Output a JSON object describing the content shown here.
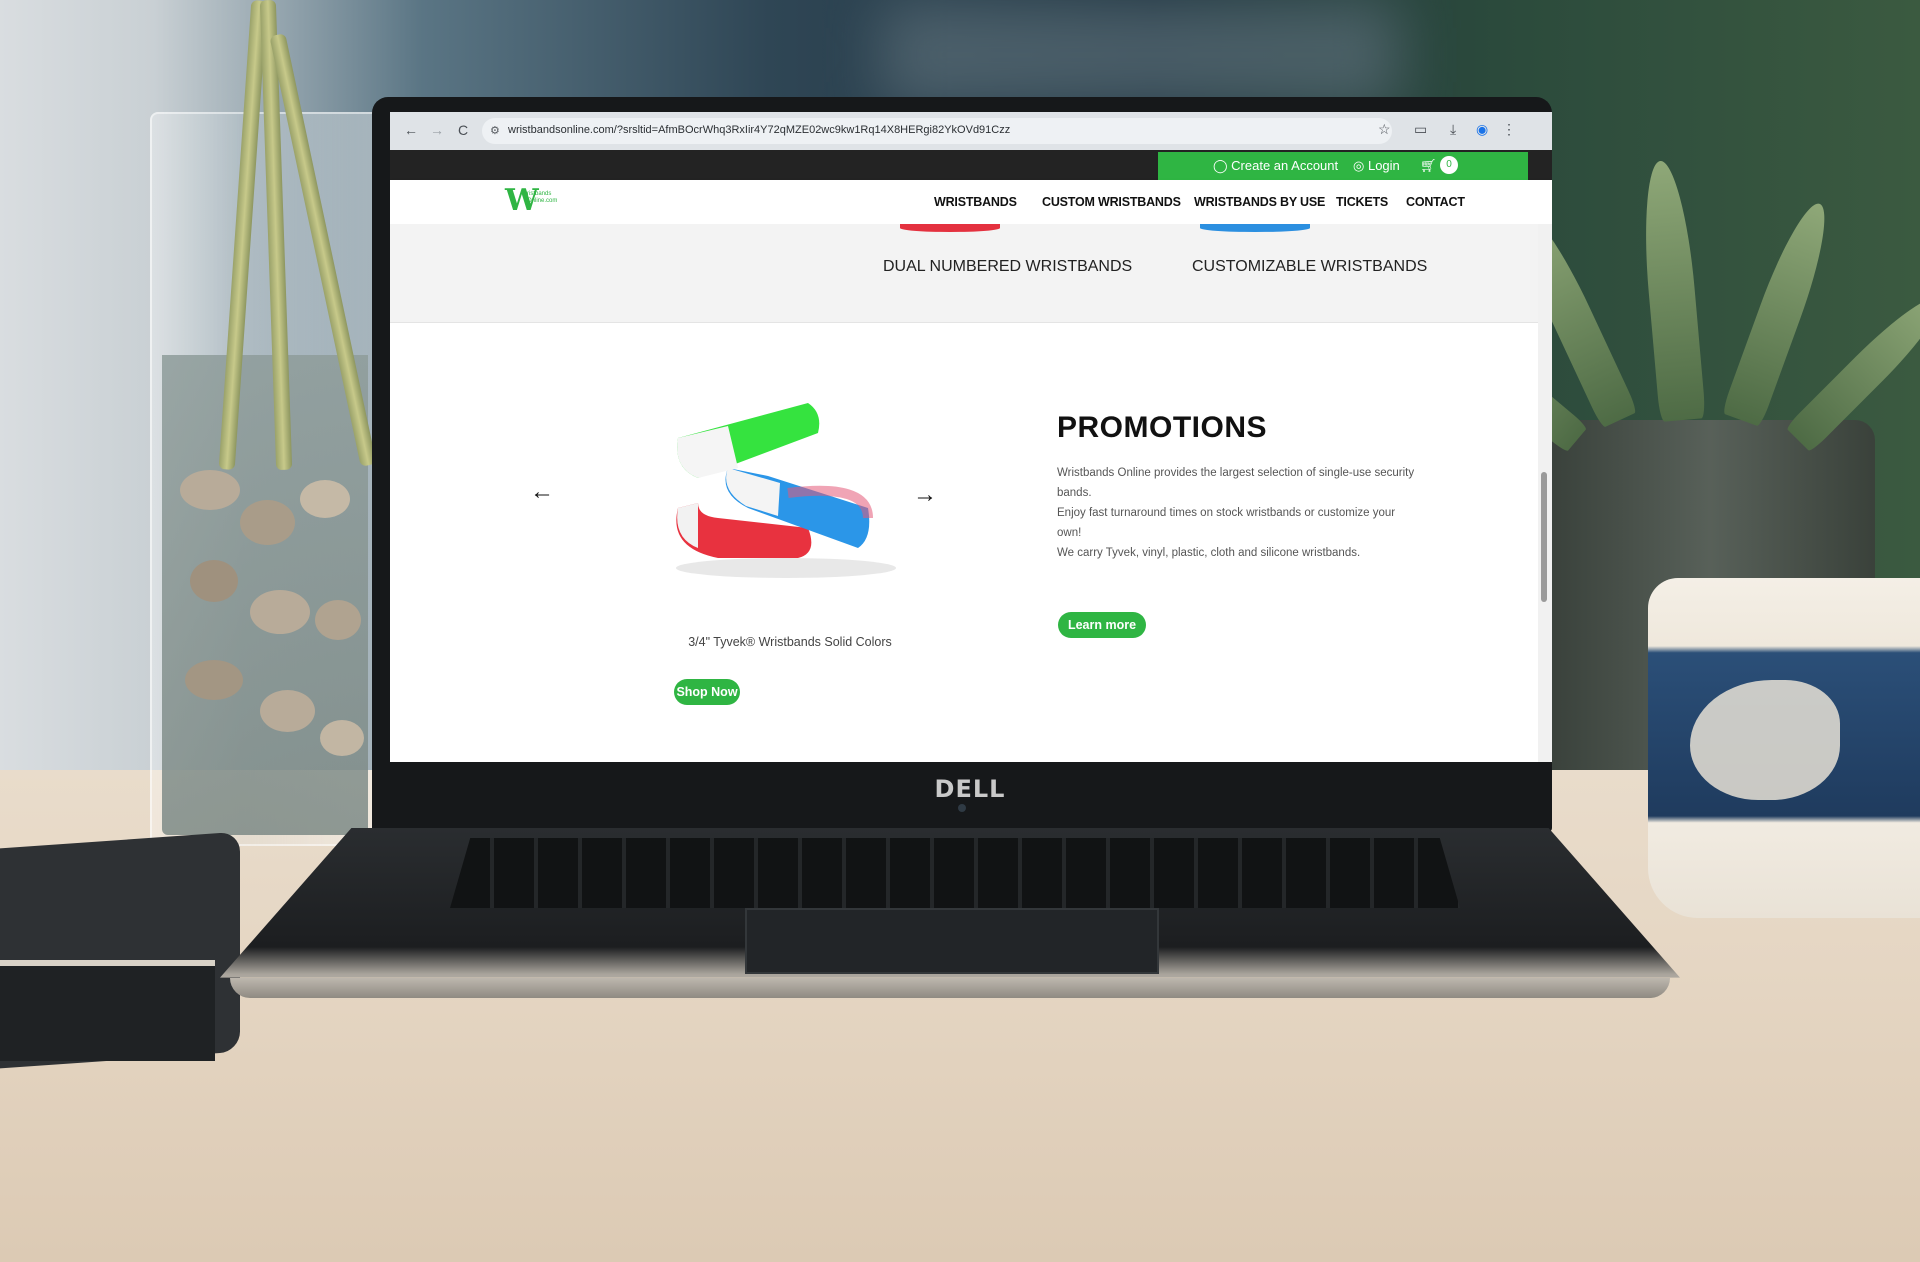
{
  "browser": {
    "url": "wristbandsonline.com/?srsltid=AfmBOcrWhq3RxIir4Y72qMZE02wc9kw1Rq14X8HERgi82YkOVd91Czz",
    "back_icon": "←",
    "forward_icon": "→",
    "reload_icon": "C"
  },
  "topbar": {
    "create_account": "Create an Account",
    "login": "Login",
    "cart_count": "0"
  },
  "nav": {
    "items": [
      "WRISTBANDS",
      "CUSTOM WRISTBANDS",
      "WRISTBANDS BY USE",
      "TICKETS",
      "CONTACT"
    ]
  },
  "categories": [
    "DUAL NUMBERED WRISTBANDS",
    "CUSTOMIZABLE WRISTBANDS"
  ],
  "promo": {
    "prev_arrow": "←",
    "next_arrow": "→",
    "product_caption": "3/4\" Tyvek® Wristbands Solid Colors",
    "shop_now": "Shop Now",
    "title": "PROMOTIONS",
    "lines": [
      "Wristbands Online provides the largest selection of single-use security bands.",
      "Enjoy fast turnaround times on stock wristbands or customize your own!",
      "We carry Tyvek, vinyl, plastic, cloth and silicone wristbands."
    ],
    "learn_more": "Learn more"
  },
  "laptop": {
    "brand": "DELL"
  },
  "colors": {
    "accent_green": "#2fb543",
    "topbar_dark": "#232323"
  }
}
